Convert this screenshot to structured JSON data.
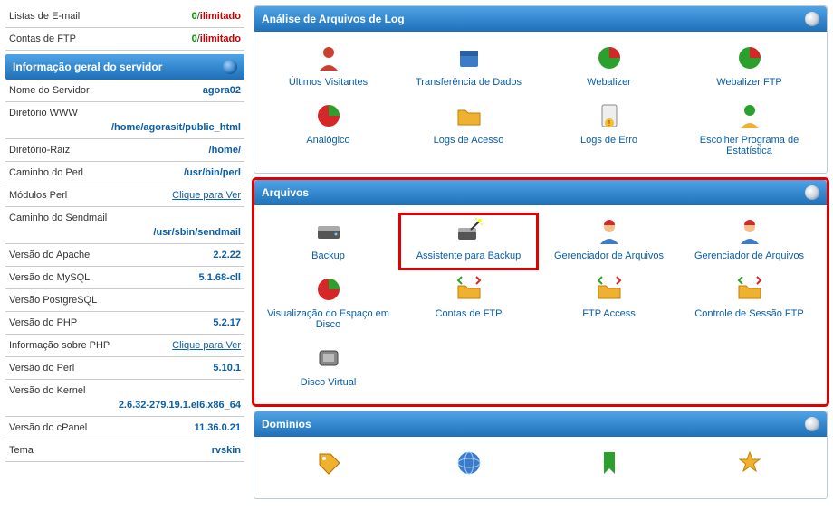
{
  "sidebar": {
    "stats_top": [
      {
        "label": "Listas de E-mail",
        "used": "0",
        "limit": "ilimitado"
      },
      {
        "label": "Contas de FTP",
        "used": "0",
        "limit": "ilimitado"
      }
    ],
    "server_panel_title": "Informação geral do servidor",
    "server_rows": [
      {
        "label": "Nome do Servidor",
        "value": "agora02",
        "type": "val"
      },
      {
        "label": "Diretório WWW",
        "value": "/home/agorasit/public_html",
        "type": "val",
        "wrap": true
      },
      {
        "label": "Diretório-Raiz",
        "value": "/home/",
        "type": "val"
      },
      {
        "label": "Caminho do Perl",
        "value": "/usr/bin/perl",
        "type": "val"
      },
      {
        "label": "Módulos Perl",
        "value": "Clique para Ver",
        "type": "link"
      },
      {
        "label": "Caminho do Sendmail",
        "value": "/usr/sbin/sendmail",
        "type": "val",
        "wrap": true
      },
      {
        "label": "Versão do Apache",
        "value": "2.2.22",
        "type": "val"
      },
      {
        "label": "Versão do MySQL",
        "value": "5.1.68-cll",
        "type": "val"
      },
      {
        "label": "Versão PostgreSQL",
        "value": "",
        "type": "val"
      },
      {
        "label": "Versão do PHP",
        "value": "5.2.17",
        "type": "val"
      },
      {
        "label": "Informação sobre PHP",
        "value": "Clique para Ver",
        "type": "link"
      },
      {
        "label": "Versão do Perl",
        "value": "5.10.1",
        "type": "val"
      },
      {
        "label": "Versão do Kernel",
        "value": "2.6.32-279.19.1.el6.x86_64",
        "type": "val",
        "wrap": true
      },
      {
        "label": "Versão do cPanel",
        "value": "11.36.0.21",
        "type": "val"
      },
      {
        "label": "Tema",
        "value": "rvskin",
        "type": "val"
      }
    ]
  },
  "groups": [
    {
      "title": "Análise de Arquivos de Log",
      "highlight": false,
      "items": [
        {
          "label": "Últimos Visitantes",
          "icon": "person-red"
        },
        {
          "label": "Transferência de Dados",
          "icon": "box-blue"
        },
        {
          "label": "Webalizer",
          "icon": "pie-red-green"
        },
        {
          "label": "Webalizer FTP",
          "icon": "pie-red-green"
        },
        {
          "label": "Analógico",
          "icon": "pie-green-red"
        },
        {
          "label": "Logs de Acesso",
          "icon": "folder"
        },
        {
          "label": "Logs de Erro",
          "icon": "clipboard-alert"
        },
        {
          "label": "Escolher Programa de Estatística",
          "icon": "person-green"
        }
      ]
    },
    {
      "title": "Arquivos",
      "highlight": true,
      "items": [
        {
          "label": "Backup",
          "icon": "hdd"
        },
        {
          "label": "Assistente para Backup",
          "icon": "hdd-wand",
          "highlight": true
        },
        {
          "label": "Gerenciador de Arquivos",
          "icon": "worker"
        },
        {
          "label": "Gerenciador de Arquivos",
          "icon": "worker"
        },
        {
          "label": "Visualização do Espaço em Disco",
          "icon": "pie-green-red"
        },
        {
          "label": "Contas de FTP",
          "icon": "folder-arrows"
        },
        {
          "label": "FTP Access",
          "icon": "folder-arrows"
        },
        {
          "label": "Controle de Sessão FTP",
          "icon": "folder-arrows"
        },
        {
          "label": "Disco Virtual",
          "icon": "disk"
        }
      ]
    },
    {
      "title": "Domínios",
      "highlight": false,
      "items": [
        {
          "label": "",
          "icon": "tag"
        },
        {
          "label": "",
          "icon": "globe"
        },
        {
          "label": "",
          "icon": "bookmark"
        },
        {
          "label": "",
          "icon": "star"
        }
      ]
    }
  ]
}
